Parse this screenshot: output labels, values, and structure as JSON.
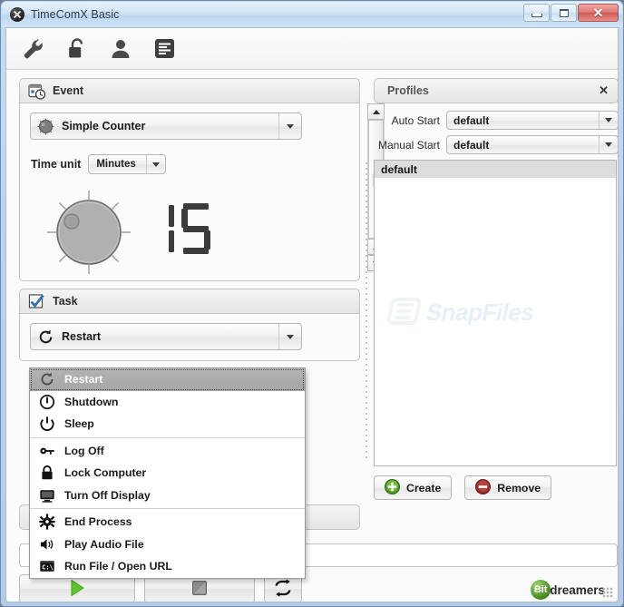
{
  "window": {
    "title": "TimeComX Basic",
    "icon": "app-x-icon",
    "controls": {
      "minimize": "minimize-icon",
      "maximize": "maximize-icon",
      "close": "close-icon",
      "close_label": "✕"
    }
  },
  "toolbar": {
    "items": [
      {
        "name": "settings-wrench-icon"
      },
      {
        "name": "unlock-padlock-icon"
      },
      {
        "name": "user-person-icon"
      },
      {
        "name": "log-list-icon"
      }
    ]
  },
  "event": {
    "title": "Event",
    "icon": "calendar-clock-icon",
    "mode": "Simple Counter",
    "mode_icon": "knob-icon",
    "time_unit_label": "Time unit",
    "time_unit_value": "Minutes",
    "counter_value": "15",
    "knob_icon": "rotary-knob-dial"
  },
  "task": {
    "title": "Task",
    "icon": "checkmark-icon",
    "selected": "Restart",
    "selected_icon": "restart-icon",
    "options": [
      {
        "label": "Restart",
        "icon": "restart-icon",
        "selected": true,
        "sep_after": false
      },
      {
        "label": "Shutdown",
        "icon": "power-off-icon",
        "selected": false,
        "sep_after": false
      },
      {
        "label": "Sleep",
        "icon": "sleep-power-icon",
        "selected": false,
        "sep_after": true
      },
      {
        "label": "Log Off",
        "icon": "key-icon",
        "selected": false,
        "sep_after": false
      },
      {
        "label": "Lock Computer",
        "icon": "lock-padlock-icon",
        "selected": false,
        "sep_after": false
      },
      {
        "label": "Turn Off Display",
        "icon": "monitor-icon",
        "selected": false,
        "sep_after": true
      },
      {
        "label": "End Process",
        "icon": "gear-icon",
        "selected": false,
        "sep_after": false
      },
      {
        "label": "Play Audio File",
        "icon": "speaker-icon",
        "selected": false,
        "sep_after": false
      },
      {
        "label": "Run File / Open URL",
        "icon": "console-prompt-icon",
        "selected": false,
        "sep_after": false
      }
    ]
  },
  "profiles": {
    "title": "Profiles",
    "close_label": "✕",
    "auto_start_label": "Auto Start",
    "auto_start_value": "default",
    "manual_start_label": "Manual Start",
    "manual_start_value": "default",
    "list": [
      {
        "label": "default",
        "selected": true
      }
    ],
    "watermark": "SnapFiles",
    "create_label": "Create",
    "create_icon": "plus-circle-icon",
    "remove_label": "Remove",
    "remove_icon": "minus-circle-icon"
  },
  "transport": {
    "play_icon": "play-icon",
    "stop_icon": "stop-icon",
    "loop_icon": "loop-repeat-icon"
  },
  "brand": {
    "mark": "Bit",
    "text": "dreamers"
  },
  "colors": {
    "accent_green": "#5aa832",
    "accent_red": "#b23b35",
    "title_bar": "#cfe2f5",
    "window_border": "#6d8bb0",
    "selection_gray": "#aaaaaa",
    "watermark_blue": "#cfe0ef"
  }
}
